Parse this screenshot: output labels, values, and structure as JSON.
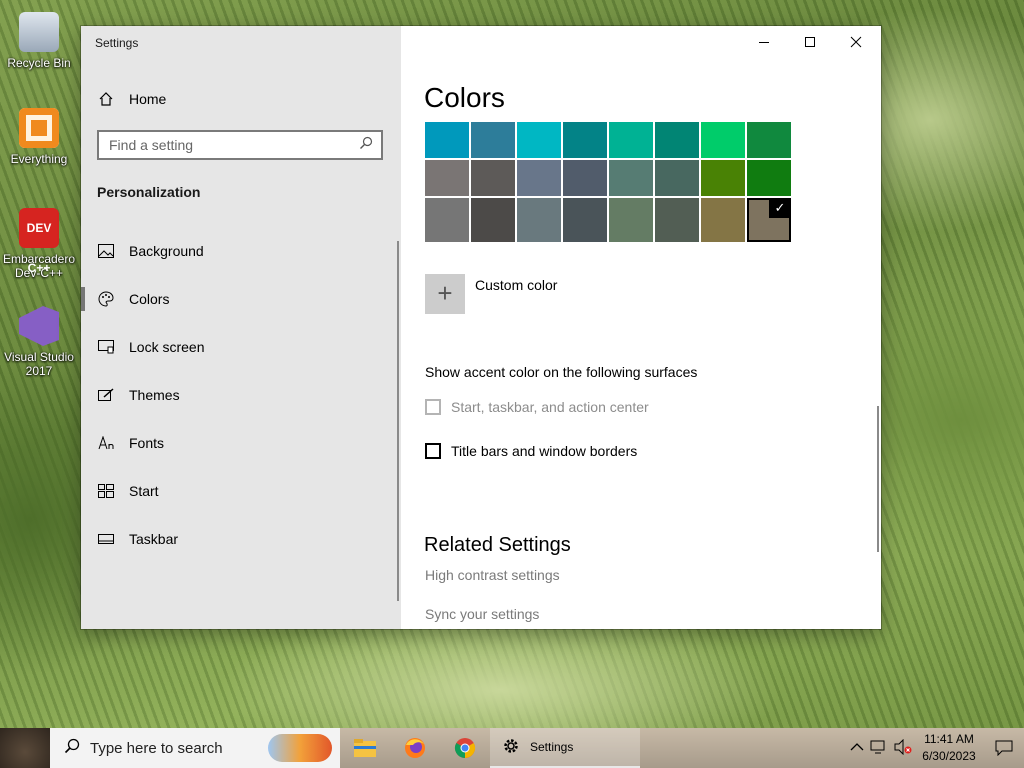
{
  "desktop": {
    "icons": [
      {
        "label": "Recycle Bin"
      },
      {
        "label": "Everything"
      },
      {
        "label": "Embarcadero Dev-C++",
        "badge": "DEV C++"
      },
      {
        "label": "Visual Studio 2017"
      }
    ]
  },
  "window": {
    "title": "Settings",
    "controls": {
      "minimize": "minimize-icon",
      "maximize": "maximize-icon",
      "close": "close-icon"
    }
  },
  "sidebar": {
    "home_label": "Home",
    "search_placeholder": "Find a setting",
    "section_title": "Personalization",
    "items": [
      {
        "label": "Background",
        "icon": "image-icon"
      },
      {
        "label": "Colors",
        "icon": "palette-icon",
        "active": true
      },
      {
        "label": "Lock screen",
        "icon": "lock-screen-icon"
      },
      {
        "label": "Themes",
        "icon": "themes-icon"
      },
      {
        "label": "Fonts",
        "icon": "fonts-icon"
      },
      {
        "label": "Start",
        "icon": "start-icon"
      },
      {
        "label": "Taskbar",
        "icon": "taskbar-icon"
      }
    ]
  },
  "main": {
    "title": "Colors",
    "swatch_rows": [
      [
        "#0099bc",
        "#2d7d9a",
        "#00b7c3",
        "#038387",
        "#00b294",
        "#018574",
        "#00cc6a",
        "#10893e"
      ],
      [
        "#7a7574",
        "#5d5a58",
        "#68768a",
        "#515c6b",
        "#567c73",
        "#486860",
        "#498205",
        "#107c10"
      ],
      [
        "#767676",
        "#4c4a48",
        "#69797e",
        "#4a5459",
        "#647c64",
        "#525e54",
        "#847545",
        "#7e735f"
      ]
    ],
    "selected_swatch": "#7e735f",
    "custom_color_label": "Custom color",
    "surfaces_heading": "Show accent color on the following surfaces",
    "checkbox_start": "Start, taskbar, and action center",
    "checkbox_titlebars": "Title bars and window borders",
    "related_heading": "Related Settings",
    "links": [
      "High contrast settings",
      "Sync your settings"
    ]
  },
  "taskbar": {
    "search_placeholder": "Type here to search",
    "active_app_label": "Settings",
    "apps": [
      "file-explorer-icon",
      "firefox-icon",
      "chrome-icon"
    ],
    "time": "11:41 AM",
    "date": "6/30/2023"
  }
}
